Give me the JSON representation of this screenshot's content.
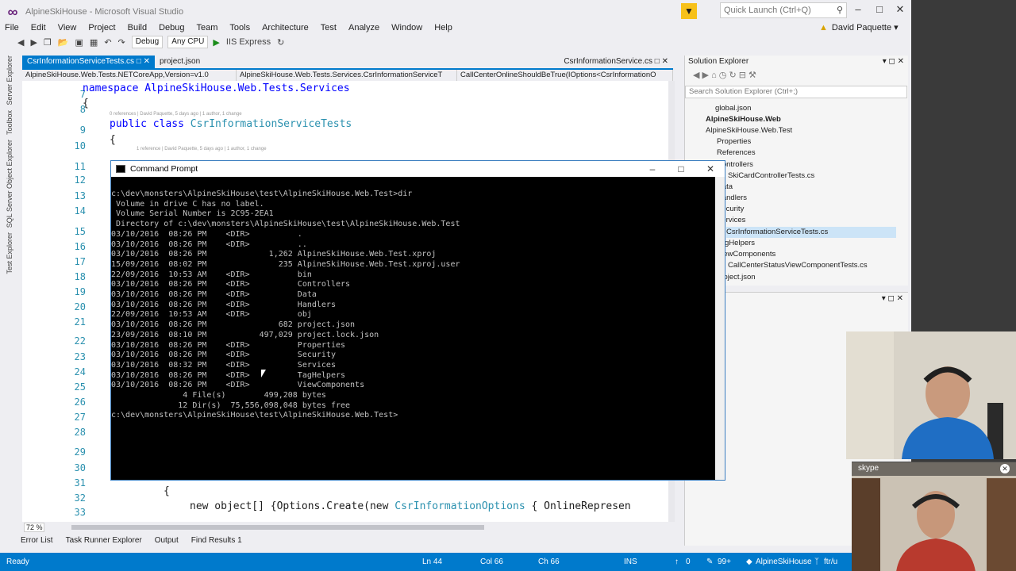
{
  "window": {
    "title": "AlpineSkiHouse - Microsoft Visual Studio",
    "quick_launch": "Quick Launch (Ctrl+Q)",
    "user": "David Paquette"
  },
  "menu": [
    "File",
    "Edit",
    "View",
    "Project",
    "Build",
    "Debug",
    "Team",
    "Tools",
    "Architecture",
    "Test",
    "Analyze",
    "Window",
    "Help"
  ],
  "toolbar": {
    "config": "Debug",
    "platform": "Any CPU",
    "run": "IIS Express"
  },
  "left_strip": [
    "Server Explorer",
    "Toolbox",
    "SQL Server Object Explorer",
    "Test Explorer"
  ],
  "tabs": [
    {
      "label": "CsrInformationServiceTests.cs",
      "active": true
    },
    {
      "label": "project.json",
      "active": false
    },
    {
      "label": "CsrInformationService.cs",
      "active": false
    }
  ],
  "navbar": [
    "AlpineSkiHouse.Web.Tests.NETCoreApp,Version=v1.0",
    "AlpineSkiHouse.Web.Tests.Services.CsrInformationServiceT",
    "CallCenterOnlineShouldBeTrue(IOptions<CsrInformationO"
  ],
  "editor": {
    "line_numbers": [
      "7",
      "8",
      "9",
      "10",
      "11",
      "12",
      "13",
      "14",
      "15",
      "16",
      "17",
      "18",
      "19",
      "20",
      "21",
      "22",
      "23",
      "24",
      "25",
      "26",
      "27",
      "28",
      "29",
      "30",
      "31",
      "32",
      "33"
    ],
    "line1": "namespace AlpineSkiHouse.Web.Tests.Services",
    "brace1": "{",
    "hint1": "0 references | David Paquette, 5 days ago | 1 author, 1 change",
    "line3_kw": "public class",
    "line3_ty": "CsrInformationServiceTests",
    "brace2": "{",
    "hint2": "1 reference | David Paquette, 5 days ago | 1 author, 1 change",
    "line32": "{",
    "line33_a": "new object[] {Options.Create(new ",
    "line33_ty": "CsrInformationOptions",
    "line33_b": " { OnlineRepresen",
    "zoom": "72 %"
  },
  "cmd": {
    "title": "Command Prompt",
    "lines": [
      "c:\\dev\\monsters\\AlpineSkiHouse\\test\\AlpineSkiHouse.Web.Test>dir",
      " Volume in drive C has no label.",
      " Volume Serial Number is 2C95-2EA1",
      "",
      " Directory of c:\\dev\\monsters\\AlpineSkiHouse\\test\\AlpineSkiHouse.Web.Test",
      "",
      "03/10/2016  08:26 PM    <DIR>          .",
      "03/10/2016  08:26 PM    <DIR>          ..",
      "03/10/2016  08:26 PM             1,262 AlpineSkiHouse.Web.Test.xproj",
      "15/09/2016  08:02 PM               235 AlpineSkiHouse.Web.Test.xproj.user",
      "22/09/2016  10:53 AM    <DIR>          bin",
      "03/10/2016  08:26 PM    <DIR>          Controllers",
      "03/10/2016  08:26 PM    <DIR>          Data",
      "03/10/2016  08:26 PM    <DIR>          Handlers",
      "22/09/2016  10:53 AM    <DIR>          obj",
      "03/10/2016  08:26 PM               682 project.json",
      "23/09/2016  08:10 PM           497,029 project.lock.json",
      "03/10/2016  08:26 PM    <DIR>          Properties",
      "03/10/2016  08:26 PM    <DIR>          Security",
      "03/10/2016  08:32 PM    <DIR>          Services",
      "03/10/2016  08:26 PM    <DIR>          TagHelpers",
      "03/10/2016  08:26 PM    <DIR>          ViewComponents",
      "               4 File(s)        499,208 bytes",
      "              12 Dir(s)  75,556,098,048 bytes free",
      "",
      "c:\\dev\\monsters\\AlpineSkiHouse\\test\\AlpineSkiHouse.Web.Test>"
    ]
  },
  "solution_explorer": {
    "title": "Solution Explorer",
    "search": "Search Solution Explorer (Ctrl+;)",
    "items": [
      {
        "label": "global.json",
        "bold": false,
        "selected": false
      },
      {
        "label": "AlpineSkiHouse.Web",
        "bold": true,
        "selected": false
      },
      {
        "label": "AlpineSkiHouse.Web.Test",
        "bold": false,
        "selected": false
      },
      {
        "label": "Properties",
        "bold": false,
        "selected": false
      },
      {
        "label": "References",
        "bold": false,
        "selected": false
      },
      {
        "label": "Controllers",
        "bold": false,
        "selected": false
      },
      {
        "label": "SkiCardControllerTests.cs",
        "bold": false,
        "selected": false
      },
      {
        "label": "Data",
        "bold": false,
        "selected": false
      },
      {
        "label": "Handlers",
        "bold": false,
        "selected": false
      },
      {
        "label": "Security",
        "bold": false,
        "selected": false
      },
      {
        "label": "Services",
        "bold": false,
        "selected": false
      },
      {
        "label": "CsrInformationServiceTests.cs",
        "bold": false,
        "selected": true
      },
      {
        "label": "TagHelpers",
        "bold": false,
        "selected": false
      },
      {
        "label": "ViewComponents",
        "bold": false,
        "selected": false
      },
      {
        "label": "CallCenterStatusViewComponentTests.cs",
        "bold": false,
        "selected": false
      },
      {
        "label": "project.json",
        "bold": false,
        "selected": false
      }
    ]
  },
  "bottom_tabs": [
    "Error List",
    "Task Runner Explorer",
    "Output",
    "Find Results 1"
  ],
  "status": {
    "ready": "Ready",
    "ln": "Ln 44",
    "col": "Col 66",
    "ch": "Ch 66",
    "ins": "INS",
    "up": "0",
    "pencil": "99+",
    "project": "AlpineSkiHouse",
    "branch": "ftr/u"
  },
  "skype": {
    "label": "skype"
  }
}
